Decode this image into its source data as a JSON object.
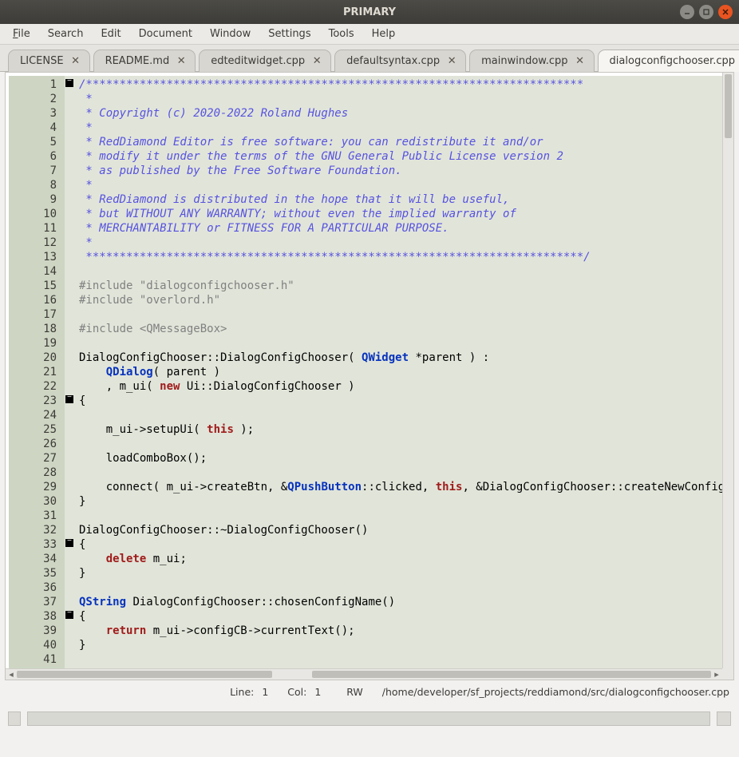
{
  "window": {
    "title": "PRIMARY"
  },
  "menus": {
    "file": "File",
    "search": "Search",
    "edit": "Edit",
    "document": "Document",
    "window": "Window",
    "settings": "Settings",
    "tools": "Tools",
    "help": "Help"
  },
  "tabs": [
    {
      "label": "LICENSE"
    },
    {
      "label": "README.md"
    },
    {
      "label": "edteditwidget.cpp"
    },
    {
      "label": "defaultsyntax.cpp"
    },
    {
      "label": "mainwindow.cpp"
    },
    {
      "label": "dialogconfigchooser.cpp",
      "active": true
    }
  ],
  "line_start": 1,
  "line_end": 41,
  "fold_lines": [
    1,
    23,
    33,
    38
  ],
  "code_tokens": [
    [
      {
        "c": "comment",
        "t": "/**************************************************************************"
      }
    ],
    [
      {
        "c": "comment",
        "t": " *"
      }
    ],
    [
      {
        "c": "comment",
        "t": " * Copyright (c) 2020-2022 Roland Hughes"
      }
    ],
    [
      {
        "c": "comment",
        "t": " *"
      }
    ],
    [
      {
        "c": "comment",
        "t": " * RedDiamond Editor is free software: you can redistribute it and/or"
      }
    ],
    [
      {
        "c": "comment",
        "t": " * modify it under the terms of the GNU General Public License version 2"
      }
    ],
    [
      {
        "c": "comment",
        "t": " * as published by the Free Software Foundation."
      }
    ],
    [
      {
        "c": "comment",
        "t": " *"
      }
    ],
    [
      {
        "c": "comment",
        "t": " * RedDiamond is distributed in the hope that it will be useful,"
      }
    ],
    [
      {
        "c": "comment",
        "t": " * but WITHOUT ANY WARRANTY; without even the implied warranty of"
      }
    ],
    [
      {
        "c": "comment",
        "t": " * MERCHANTABILITY or FITNESS FOR A PARTICULAR PURPOSE."
      }
    ],
    [
      {
        "c": "comment",
        "t": " *"
      }
    ],
    [
      {
        "c": "comment",
        "t": " **************************************************************************/"
      }
    ],
    [],
    [
      {
        "c": "pre",
        "t": "#include \"dialogconfigchooser.h\""
      }
    ],
    [
      {
        "c": "pre",
        "t": "#include \"overlord.h\""
      }
    ],
    [],
    [
      {
        "c": "pre",
        "t": "#include <QMessageBox>"
      }
    ],
    [],
    [
      {
        "t": "DialogConfigChooser::DialogConfigChooser( "
      },
      {
        "c": "type",
        "t": "QWidget"
      },
      {
        "t": " *parent ) :"
      }
    ],
    [
      {
        "t": "    "
      },
      {
        "c": "type",
        "t": "QDialog"
      },
      {
        "t": "( parent )"
      }
    ],
    [
      {
        "t": "    , m_ui( "
      },
      {
        "c": "kw",
        "t": "new"
      },
      {
        "t": " Ui::DialogConfigChooser )"
      }
    ],
    [
      {
        "t": "{"
      }
    ],
    [],
    [
      {
        "t": "    m_ui->setupUi( "
      },
      {
        "c": "kw",
        "t": "this"
      },
      {
        "t": " );"
      }
    ],
    [],
    [
      {
        "t": "    loadComboBox();"
      }
    ],
    [],
    [
      {
        "t": "    connect( m_ui->createBtn, &"
      },
      {
        "c": "type",
        "t": "QPushButton"
      },
      {
        "t": "::clicked, "
      },
      {
        "c": "kw",
        "t": "this"
      },
      {
        "t": ", &DialogConfigChooser::createNewConfig );"
      }
    ],
    [
      {
        "t": "}"
      }
    ],
    [],
    [
      {
        "t": "DialogConfigChooser::~DialogConfigChooser()"
      }
    ],
    [
      {
        "t": "{"
      }
    ],
    [
      {
        "t": "    "
      },
      {
        "c": "kw",
        "t": "delete"
      },
      {
        "t": " m_ui;"
      }
    ],
    [
      {
        "t": "}"
      }
    ],
    [],
    [
      {
        "c": "type",
        "t": "QString"
      },
      {
        "t": " DialogConfigChooser::chosenConfigName()"
      }
    ],
    [
      {
        "t": "{"
      }
    ],
    [
      {
        "t": "    "
      },
      {
        "c": "kw",
        "t": "return"
      },
      {
        "t": " m_ui->configCB->currentText();"
      }
    ],
    [
      {
        "t": "}"
      }
    ],
    []
  ],
  "status": {
    "line_label": "Line:",
    "line": "1",
    "col_label": "Col:",
    "col": "1",
    "mode": "RW",
    "path": "/home/developer/sf_projects/reddiamond/src/dialogconfigchooser.cpp"
  }
}
